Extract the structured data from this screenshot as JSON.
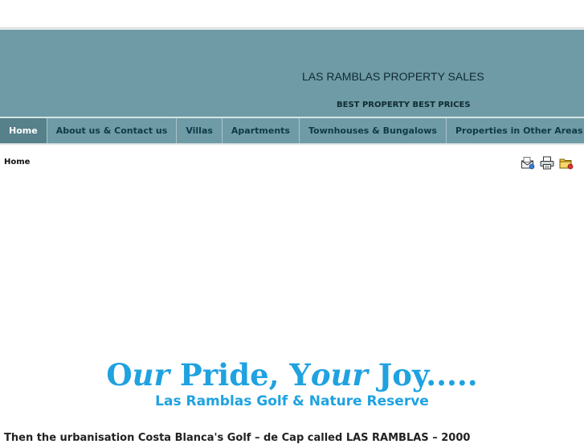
{
  "header": {
    "site_title": "LAS RAMBLAS PROPERTY SALES",
    "slogan": "BEST PROPERTY BEST PRICES"
  },
  "nav": {
    "items": [
      {
        "label": "Home",
        "active": true
      },
      {
        "label": "About us & Contact us",
        "active": false
      },
      {
        "label": "Villas",
        "active": false
      },
      {
        "label": "Apartments",
        "active": false
      },
      {
        "label": "Townhouses & Bungalows",
        "active": false
      },
      {
        "label": "Properties in Other Areas",
        "active": false
      }
    ]
  },
  "breadcrumb": {
    "current": "Home"
  },
  "tools": {
    "email": "email-icon",
    "print": "print-icon",
    "pdf": "pdf-icon"
  },
  "content": {
    "heading_parts": [
      "O",
      "ur",
      " Pride, Y",
      "our",
      " Joy....."
    ],
    "subheading": "Las Ramblas Golf & Nature Reserve",
    "intro": "Then the urbanisation Costa Blanca's Golf – de Cap called LAS RAMBLAS – 2000"
  },
  "colors": {
    "banner": "#6e9ba5",
    "active_tab": "#56808a",
    "accent": "#1fa2e0"
  }
}
